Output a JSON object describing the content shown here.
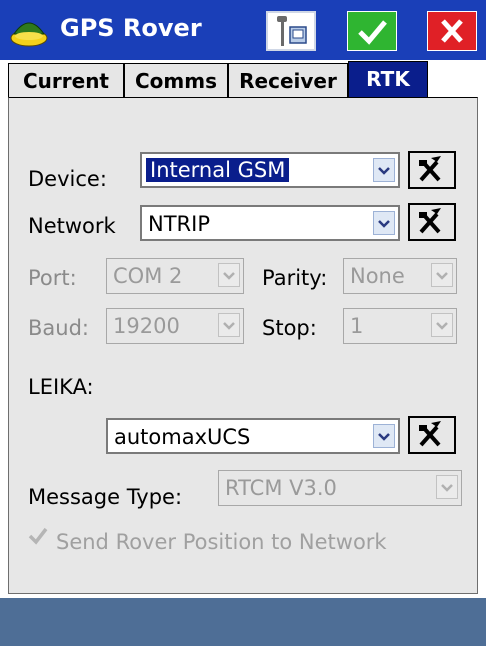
{
  "window": {
    "title": "GPS Rover",
    "buttons": {
      "rover": "rover-settings",
      "ok": "ok",
      "cancel": "close"
    }
  },
  "tabs": [
    {
      "label": "Current",
      "active": false
    },
    {
      "label": "Comms",
      "active": false
    },
    {
      "label": "Receiver",
      "active": false
    },
    {
      "label": "RTK",
      "active": true
    }
  ],
  "form": {
    "device": {
      "label": "Device:",
      "value": "Internal GSM"
    },
    "network": {
      "label": "Network",
      "value": "NTRIP"
    },
    "port": {
      "label": "Port:",
      "value": "COM 2"
    },
    "parity": {
      "label": "Parity:",
      "value": "None"
    },
    "baud": {
      "label": "Baud:",
      "value": "19200"
    },
    "stop": {
      "label": "Stop:",
      "value": "1"
    },
    "section_label": "LEIKA:",
    "mount": {
      "value": "automaxUCS"
    },
    "message_type": {
      "label": "Message Type:",
      "value": "RTCM V3.0"
    },
    "send_position": {
      "label": "Send Rover Position to Network",
      "checked": true,
      "enabled": false
    }
  },
  "colors": {
    "titlebar": "#1a3fb8",
    "selection": "#0a1e8c",
    "panel": "#e7e7e7",
    "taskbar": "#4e6e96"
  }
}
